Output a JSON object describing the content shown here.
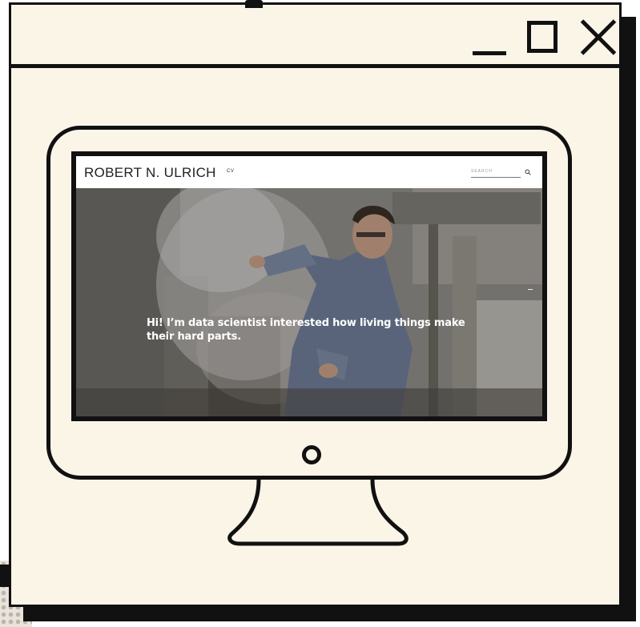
{
  "window": {
    "minimize_icon": "minimize-icon",
    "maximize_icon": "maximize-icon",
    "close_icon": "close-icon"
  },
  "site": {
    "title": "ROBERT N. ULRICH",
    "nav": {
      "cv": "CV"
    },
    "search": {
      "placeholder": "SEARCH",
      "icon": "search-icon"
    },
    "hero": {
      "text": "Hi! I’m data scientist interested how living things make their hard parts.",
      "image": "scientist-in-lab-coat-with-liquid-nitrogen-vapor"
    }
  },
  "colors": {
    "window_bg": "#fbf5e8",
    "outline": "#111111"
  }
}
